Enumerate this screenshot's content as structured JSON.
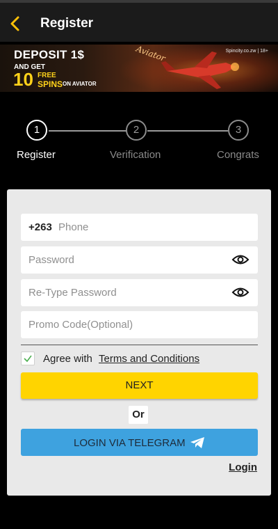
{
  "header": {
    "title": "Register",
    "back_icon": "chevron-left-icon",
    "accent": "#ffc107"
  },
  "banner": {
    "line1": "DEPOSIT 1$",
    "line2": "AND GET",
    "big_number": "10",
    "free": "FREE",
    "spins": "SPINS",
    "on": "ON AVIATOR",
    "site": "Spincity.co.zw | 18+",
    "aviator_text": "Aviator"
  },
  "steps": [
    {
      "number": "1",
      "label": "Register",
      "active": true
    },
    {
      "number": "2",
      "label": "Verification",
      "active": false
    },
    {
      "number": "3",
      "label": "Congrats",
      "active": false
    }
  ],
  "form": {
    "phone_prefix": "+263",
    "phone_placeholder": "Phone",
    "password_placeholder": "Password",
    "retype_placeholder": "Re-Type Password",
    "promo_placeholder": "Promo Code(Optional)",
    "agree_text": "Agree with",
    "terms_link": "Terms and Conditions",
    "agree_checked": true,
    "next_label": "NEXT",
    "or_label": "Or",
    "telegram_label": "LOGIN VIA TELEGRAM",
    "login_link": "Login"
  },
  "colors": {
    "next_button": "#ffd400",
    "telegram_button": "#3ea2df",
    "card_bg": "#e9e9e9"
  }
}
